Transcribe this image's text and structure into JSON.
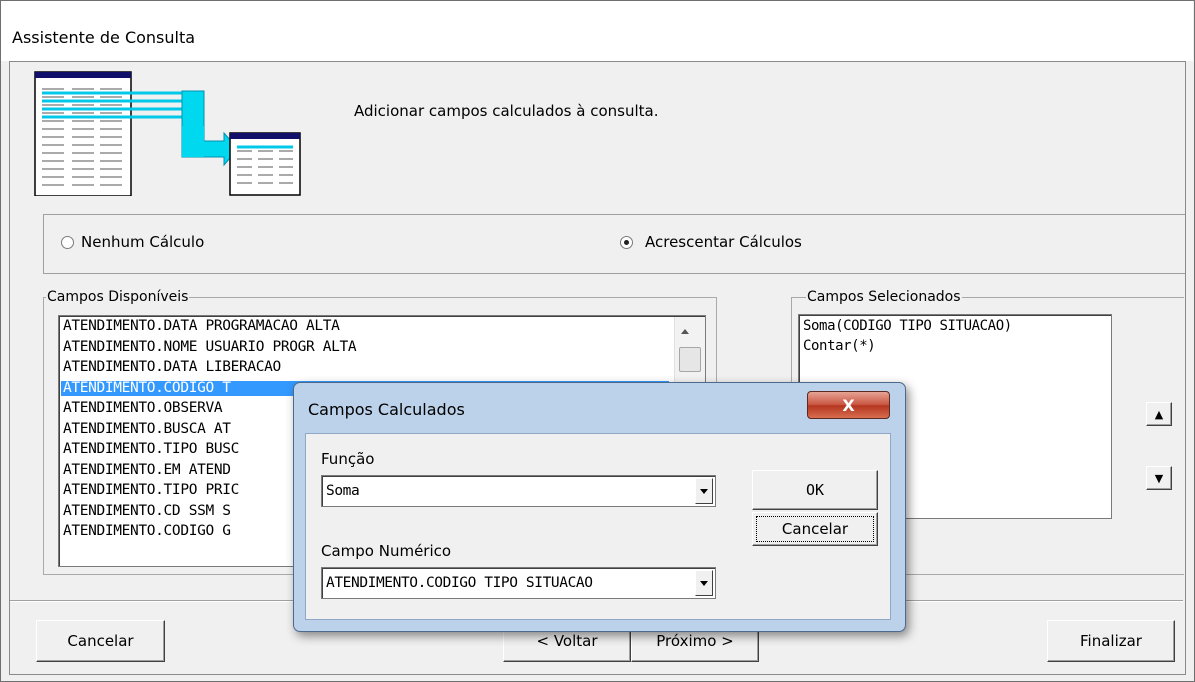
{
  "window": {
    "title": "Assistente de Consulta"
  },
  "header": {
    "description": "Adicionar campos calculados à consulta."
  },
  "calc_options": {
    "none_label": "Nenhum Cálculo",
    "add_label": "Acrescentar Cálculos",
    "selected": "add"
  },
  "available_fields": {
    "legend": "Campos Disponíveis",
    "items": [
      "ATENDIMENTO.DATA PROGRAMACAO ALTA",
      "ATENDIMENTO.NOME USUARIO PROGR ALTA",
      "ATENDIMENTO.DATA LIBERACAO",
      "ATENDIMENTO.CODIGO T",
      "ATENDIMENTO.OBSERVA",
      "ATENDIMENTO.BUSCA AT",
      "ATENDIMENTO.TIPO BUSC",
      "ATENDIMENTO.EM ATEND",
      "ATENDIMENTO.TIPO PRIC",
      "ATENDIMENTO.CD SSM S",
      "ATENDIMENTO.CODIGO G"
    ],
    "selected_index": 3
  },
  "selected_fields": {
    "legend": "Campos Selecionados",
    "items": [
      "Soma(CODIGO TIPO SITUACAO)",
      "Contar(*)"
    ]
  },
  "footer": {
    "cancel_label": "Cancelar",
    "back_label": "< Voltar",
    "next_label": "Próximo >",
    "finish_label": "Finalizar"
  },
  "dialog": {
    "title": "Campos Calculados",
    "close_label": "X",
    "function_label": "Função",
    "function_value": "Soma",
    "numeric_field_label": "Campo Numérico",
    "numeric_field_value": "ATENDIMENTO.CODIGO TIPO SITUACAO",
    "ok_label": "OK",
    "cancel_label": "Cancelar"
  },
  "icons": {
    "up": "arrow-up-icon",
    "down": "arrow-down-icon",
    "header": "table-transform-icon"
  }
}
